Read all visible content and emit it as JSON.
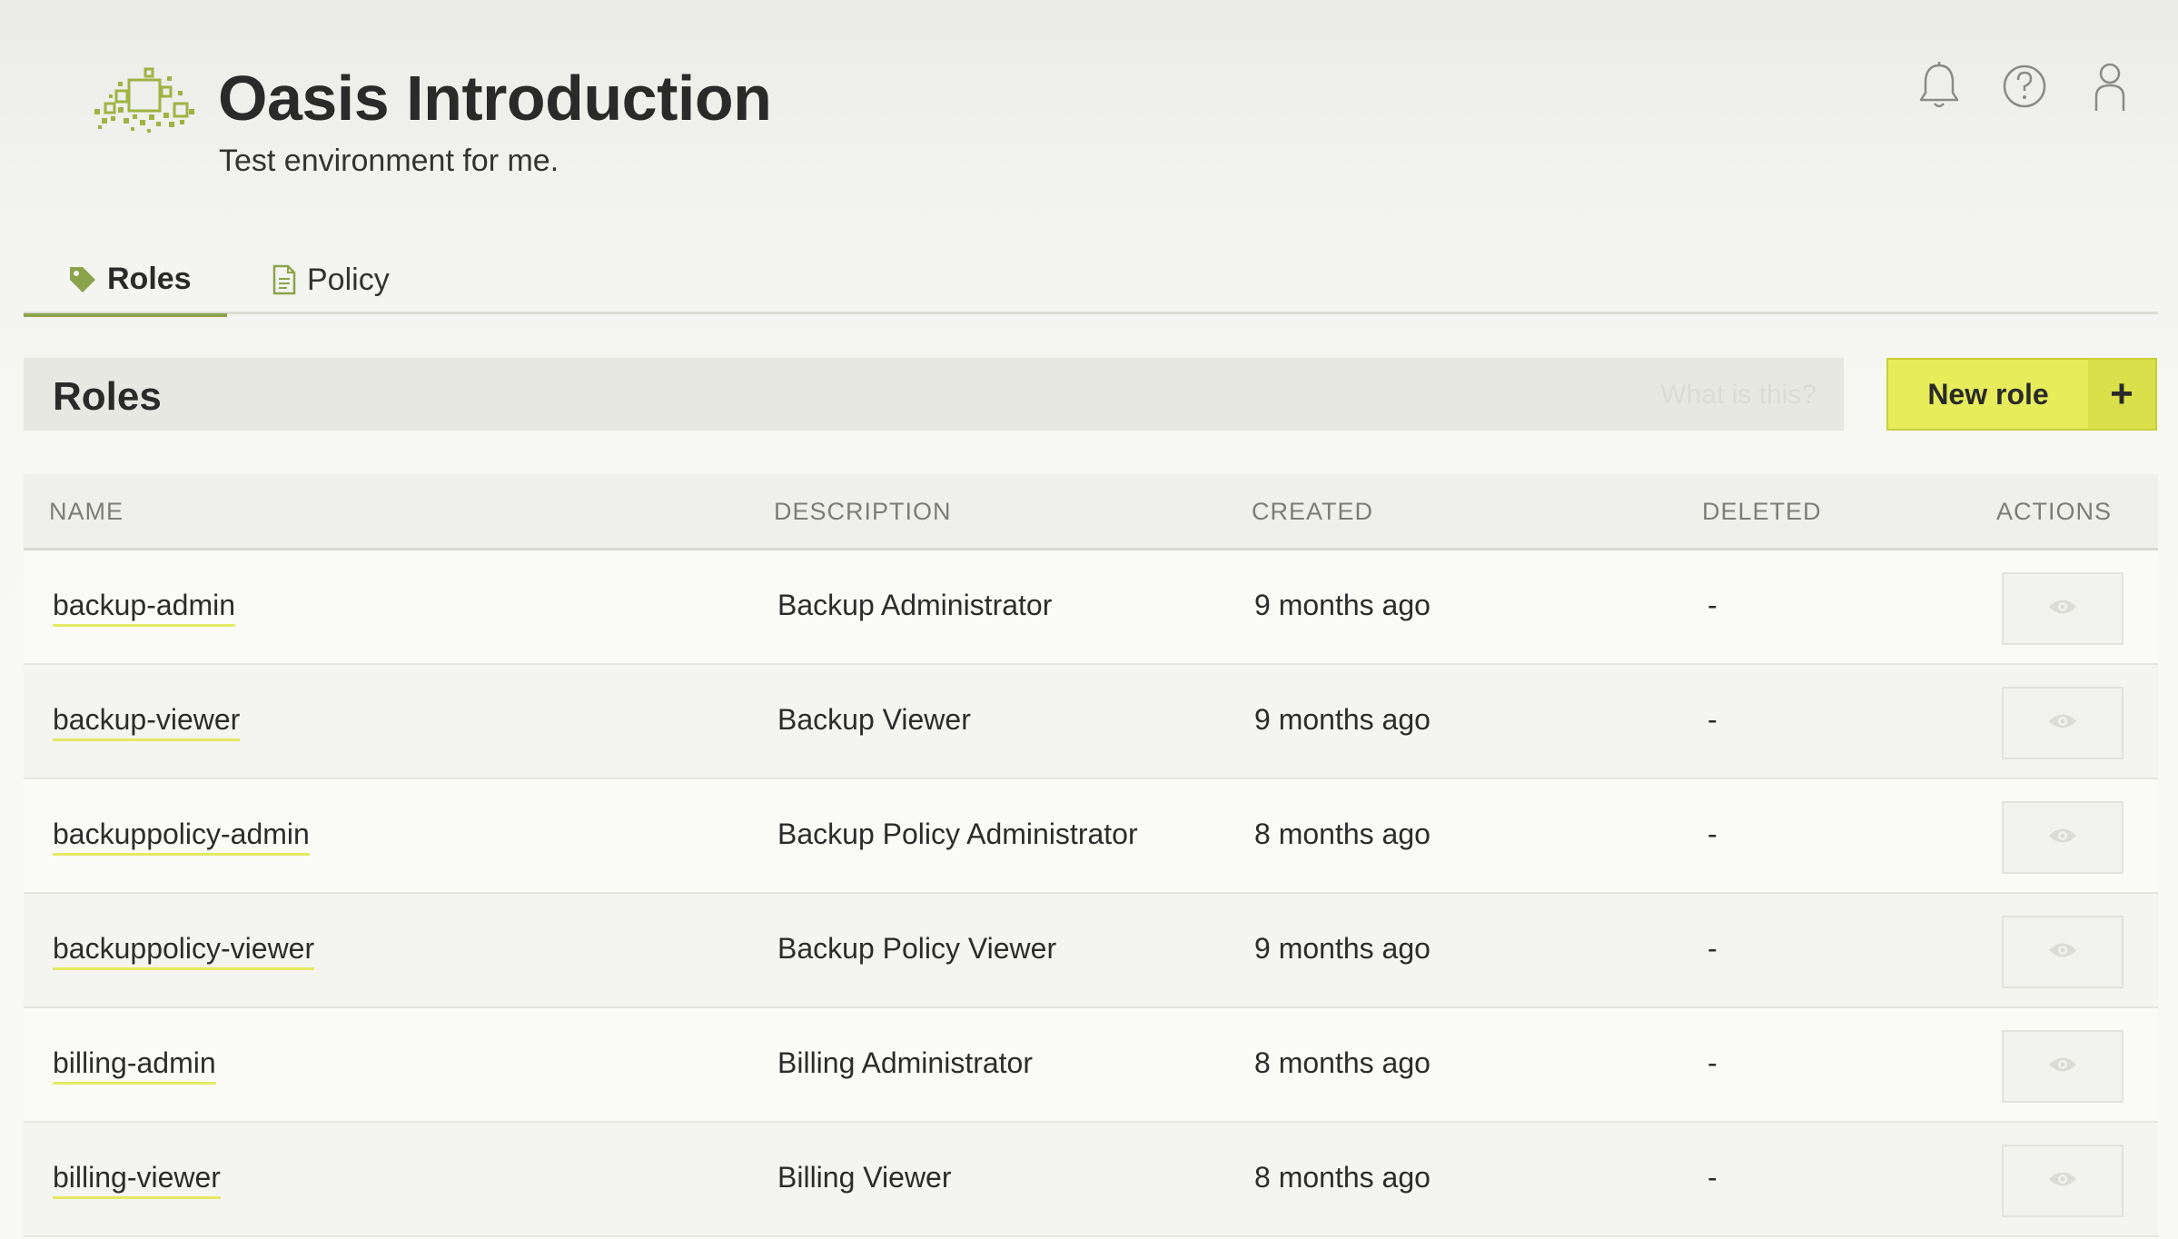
{
  "header": {
    "title": "Oasis Introduction",
    "subtitle": "Test environment for me.",
    "icons": [
      "bell-icon",
      "help-icon",
      "user-icon"
    ]
  },
  "tabs": [
    {
      "label": "Roles",
      "icon": "tag-icon",
      "active": true
    },
    {
      "label": "Policy",
      "icon": "document-icon",
      "active": false
    }
  ],
  "section": {
    "title": "Roles",
    "help_link": "What is this?",
    "new_button": "New role",
    "new_button_icon": "+"
  },
  "table": {
    "headers": [
      "NAME",
      "DESCRIPTION",
      "CREATED",
      "DELETED",
      "ACTIONS"
    ],
    "rows": [
      {
        "name": "backup-admin",
        "description": "Backup Administrator",
        "created": "9 months ago",
        "deleted": "-"
      },
      {
        "name": "backup-viewer",
        "description": "Backup Viewer",
        "created": "9 months ago",
        "deleted": "-"
      },
      {
        "name": "backuppolicy-admin",
        "description": "Backup Policy Administrator",
        "created": "8 months ago",
        "deleted": "-"
      },
      {
        "name": "backuppolicy-viewer",
        "description": "Backup Policy Viewer",
        "created": "9 months ago",
        "deleted": "-"
      },
      {
        "name": "billing-admin",
        "description": "Billing Administrator",
        "created": "8 months ago",
        "deleted": "-"
      },
      {
        "name": "billing-viewer",
        "description": "Billing Viewer",
        "created": "8 months ago",
        "deleted": "-"
      }
    ]
  },
  "colors": {
    "accent": "#e6ec5a",
    "tab_underline": "#8ba34b",
    "logo": "#9fb343"
  }
}
